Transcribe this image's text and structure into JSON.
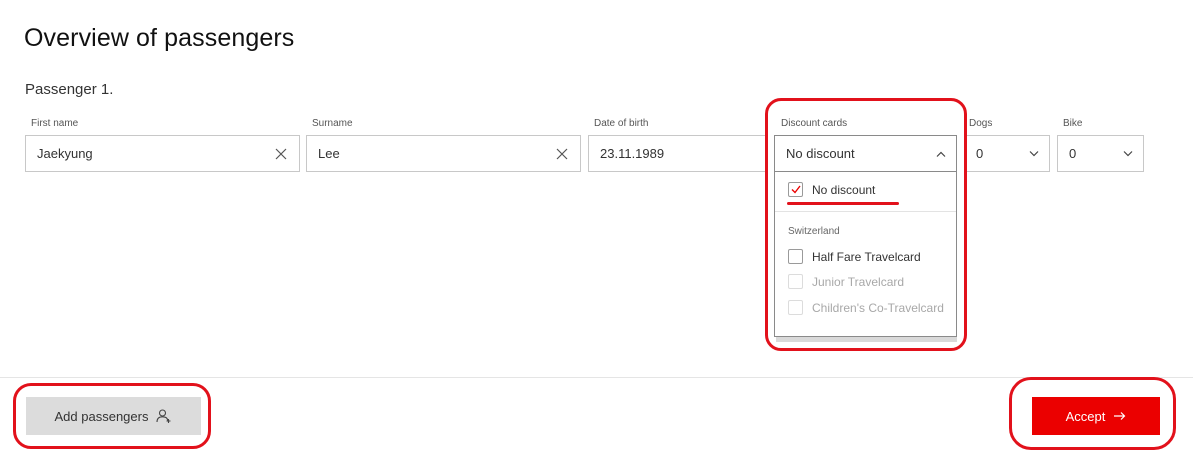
{
  "page": {
    "title": "Overview of passengers",
    "passenger_label": "Passenger 1."
  },
  "fields": {
    "first_name": {
      "label": "First name",
      "value": "Jaekyung"
    },
    "surname": {
      "label": "Surname",
      "value": "Lee"
    },
    "dob": {
      "label": "Date of birth",
      "value": "23.11.1989"
    },
    "discount": {
      "label": "Discount cards",
      "value": "No discount"
    },
    "dogs": {
      "label": "Dogs",
      "value": "0"
    },
    "bike": {
      "label": "Bike",
      "value": "0"
    }
  },
  "dropdown": {
    "selected_option": {
      "label": "No discount",
      "checked": true
    },
    "group_label": "Switzerland",
    "options": [
      {
        "label": "Half Fare Travelcard",
        "enabled": true,
        "checked": false
      },
      {
        "label": "Junior Travelcard",
        "enabled": false,
        "checked": false
      },
      {
        "label": "Children's Co-Travelcard",
        "enabled": false,
        "checked": false
      }
    ]
  },
  "footer": {
    "add_label": "Add passengers",
    "accept_label": "Accept"
  },
  "colors": {
    "accent": "#eb0000",
    "annotation": "#e2111b",
    "secondary_button": "#dcdcdc"
  },
  "icons": [
    "clear-icon",
    "chevron-up-icon",
    "chevron-down-icon",
    "checkmark-icon",
    "add-person-icon",
    "arrow-right-icon"
  ]
}
